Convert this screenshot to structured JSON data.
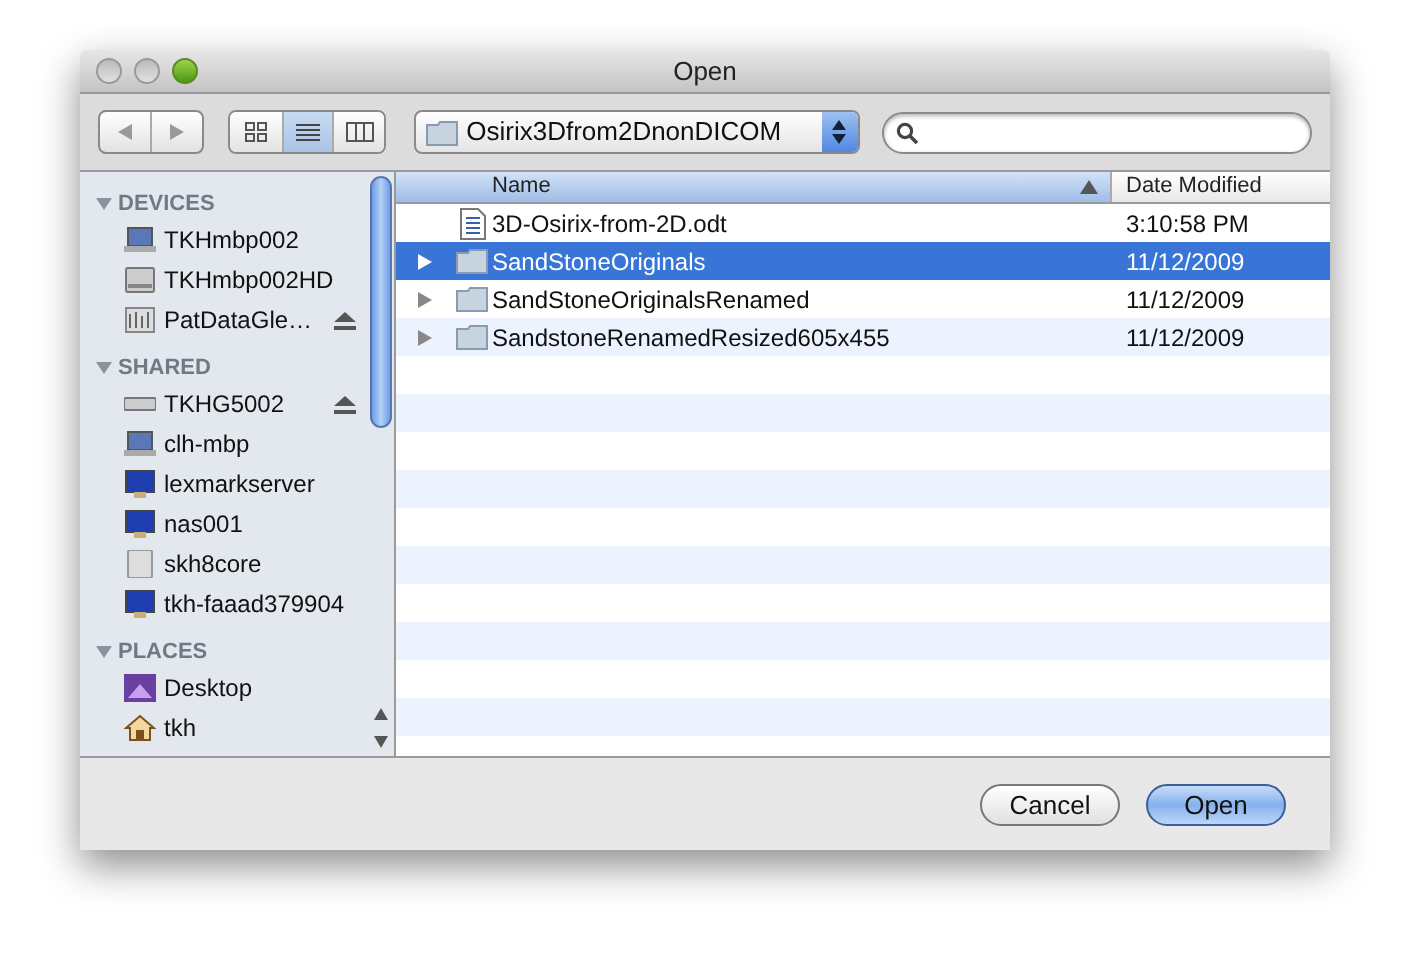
{
  "window": {
    "title": "Open"
  },
  "toolbar": {
    "view_modes": [
      {
        "kind": "icons",
        "selected": false
      },
      {
        "kind": "list",
        "selected": true
      },
      {
        "kind": "columns",
        "selected": false
      }
    ],
    "location": "Osirix3Dfrom2DnonDICOM"
  },
  "sidebar": {
    "sections": [
      {
        "title": "DEVICES",
        "expanded": true,
        "items": [
          {
            "label": "TKHmbp002",
            "kind": "laptop",
            "ejectable": false
          },
          {
            "label": "TKHmbp002HD",
            "kind": "drive",
            "ejectable": false
          },
          {
            "label": "PatDataGle…",
            "kind": "disk",
            "ejectable": true
          }
        ]
      },
      {
        "title": "SHARED",
        "expanded": true,
        "items": [
          {
            "label": "TKHG5002",
            "kind": "server",
            "ejectable": true
          },
          {
            "label": "clh-mbp",
            "kind": "laptop",
            "ejectable": false
          },
          {
            "label": "lexmarkserver",
            "kind": "monitor",
            "ejectable": false
          },
          {
            "label": "nas001",
            "kind": "monitor",
            "ejectable": false
          },
          {
            "label": "skh8core",
            "kind": "tower",
            "ejectable": false
          },
          {
            "label": "tkh-faaad379904",
            "kind": "monitor",
            "ejectable": false
          }
        ]
      },
      {
        "title": "PLACES",
        "expanded": true,
        "items": [
          {
            "label": "Desktop",
            "kind": "desktop",
            "ejectable": false
          },
          {
            "label": "tkh",
            "kind": "home",
            "ejectable": false
          }
        ]
      }
    ]
  },
  "file_list": {
    "columns": [
      {
        "label": "Name",
        "selected": true
      },
      {
        "label": "Date Modified",
        "selected": false
      }
    ],
    "rows": [
      {
        "name": "3D-Osirix-from-2D.odt",
        "kind": "document",
        "date": "3:10:58 PM",
        "selected": false
      },
      {
        "name": "SandStoneOriginals",
        "kind": "folder",
        "date": "11/12/2009",
        "selected": true
      },
      {
        "name": "SandStoneOriginalsRenamed",
        "kind": "folder",
        "date": "11/12/2009",
        "selected": false
      },
      {
        "name": "SandstoneRenamedResized605x455",
        "kind": "folder",
        "date": "11/12/2009",
        "selected": false
      }
    ]
  },
  "buttons": [
    {
      "label": "Cancel",
      "default": false
    },
    {
      "label": "Open",
      "default": true
    }
  ]
}
